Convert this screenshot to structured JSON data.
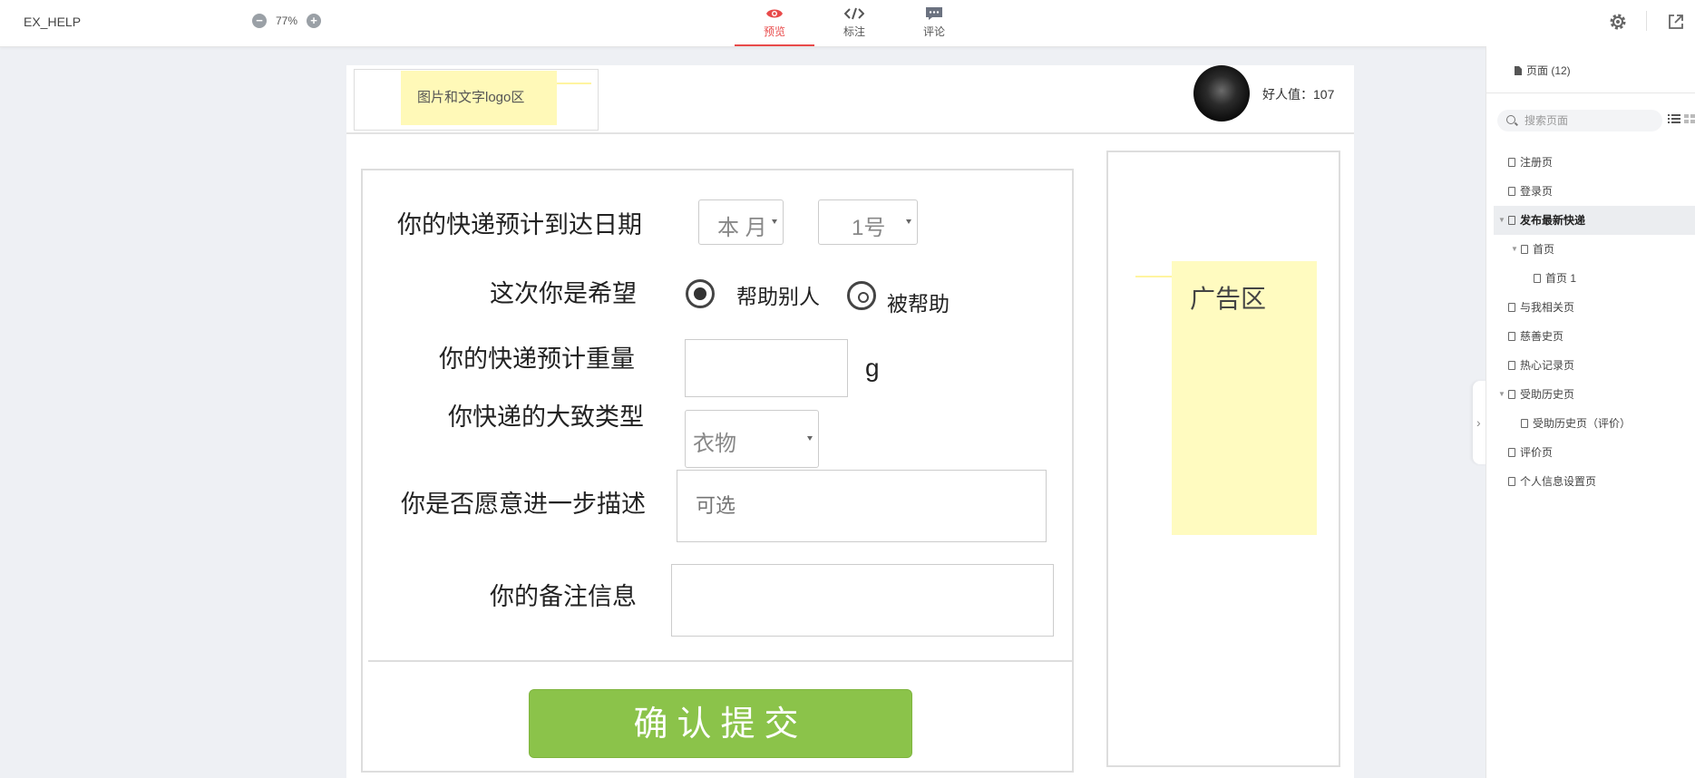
{
  "app": {
    "title": "EX_HELP"
  },
  "zoom": {
    "minus": "−",
    "level": "77%",
    "plus": "+"
  },
  "tabs": [
    {
      "label": "预览",
      "icon": "eye-icon",
      "active": true
    },
    {
      "label": "标注",
      "icon": "code-icon",
      "active": false
    },
    {
      "label": "评论",
      "icon": "comment-icon",
      "active": false
    }
  ],
  "toolbar": {
    "settings_icon": "gear-icon",
    "share_icon": "share-icon"
  },
  "canvas": {
    "logo_note": "图片和文字logo区",
    "karma_label": "好人值：107",
    "form": {
      "date_label": "你的快递预计到达日期",
      "month_select": "本 月",
      "day_select": "1号",
      "hope_label": "这次你是希望",
      "option_help_others": "帮助别人",
      "option_be_helped": "被帮助",
      "selected_option": "帮助别人",
      "weight_label": "你的快递预计重量",
      "weight_value": "",
      "weight_unit": "g",
      "type_label": "你快递的大致类型",
      "type_select": "衣物",
      "describe_label": "你是否愿意进一步描述",
      "describe_placeholder": "可选",
      "remark_label": "你的备注信息",
      "remark_value": "",
      "submit_label": "确认提交"
    },
    "ad_note": "广告区"
  },
  "sidebar": {
    "pages_title": "页面 (12)",
    "search_placeholder": "搜索页面",
    "pages": [
      {
        "label": "注册页",
        "level": 0,
        "expanded": false,
        "active": false
      },
      {
        "label": "登录页",
        "level": 0,
        "expanded": false,
        "active": false
      },
      {
        "label": "发布最新快递",
        "level": 0,
        "expanded": true,
        "active": true
      },
      {
        "label": "首页",
        "level": 1,
        "expanded": true,
        "active": false
      },
      {
        "label": "首页 1",
        "level": 2,
        "expanded": false,
        "active": false
      },
      {
        "label": "与我相关页",
        "level": 0,
        "expanded": false,
        "active": false
      },
      {
        "label": "慈善史页",
        "level": 0,
        "expanded": false,
        "active": false
      },
      {
        "label": "热心记录页",
        "level": 0,
        "expanded": false,
        "active": false
      },
      {
        "label": "受助历史页",
        "level": 0,
        "expanded": true,
        "active": false
      },
      {
        "label": "受助历史页（评价）",
        "level": 1,
        "expanded": false,
        "active": false
      },
      {
        "label": "评价页",
        "level": 0,
        "expanded": false,
        "active": false
      },
      {
        "label": "个人信息设置页",
        "level": 0,
        "expanded": false,
        "active": false
      }
    ]
  },
  "colors": {
    "accent": "#e84a4a",
    "submit": "#8bc34a",
    "note": "#fff9b8"
  }
}
